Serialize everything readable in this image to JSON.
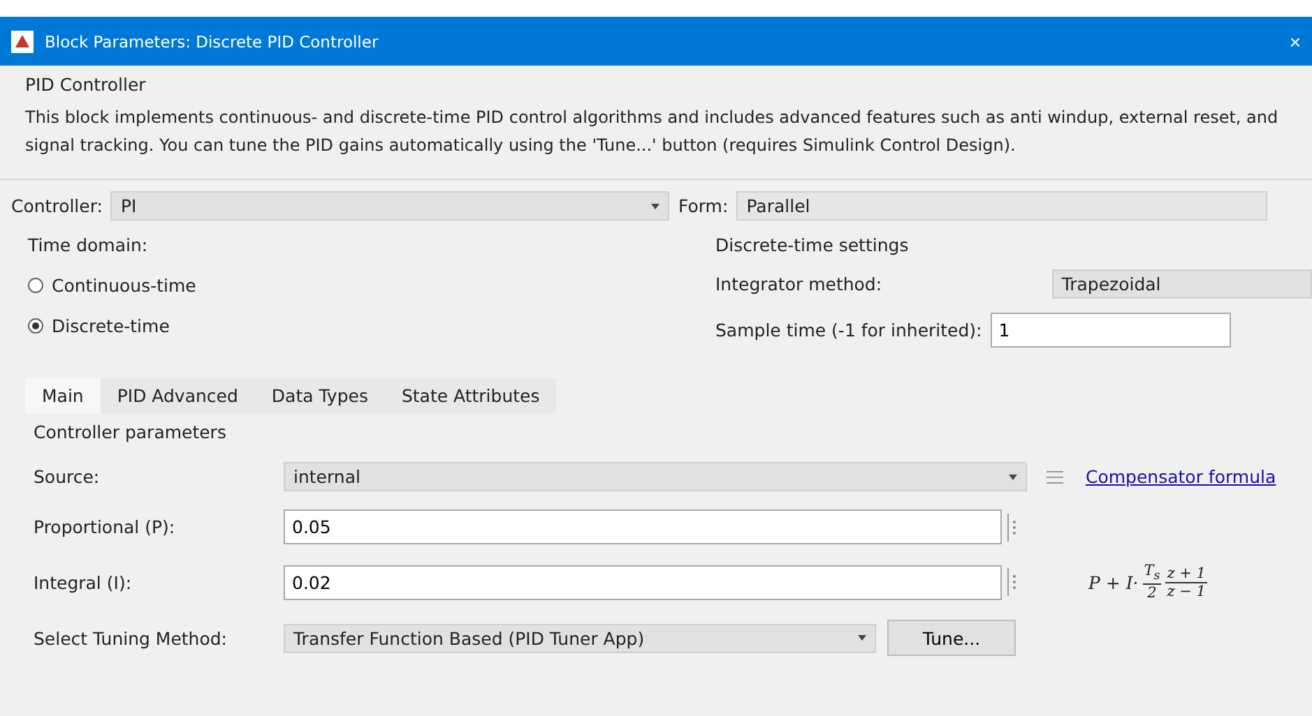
{
  "window": {
    "title": "Block Parameters: Discrete PID Controller",
    "close": "×"
  },
  "block": {
    "name": "PID Controller",
    "description": "This block implements continuous- and discrete-time PID control algorithms and includes advanced features such as anti windup, external reset, and signal tracking. You can tune the PID gains automatically using the 'Tune...' button (requires Simulink Control Design)."
  },
  "controller": {
    "label": "Controller:",
    "value": "PI"
  },
  "form": {
    "label": "Form:",
    "value": "Parallel"
  },
  "time_domain": {
    "label": "Time domain:",
    "options": [
      {
        "label": "Continuous-time",
        "selected": false
      },
      {
        "label": "Discrete-time",
        "selected": true
      }
    ]
  },
  "discrete_settings": {
    "title": "Discrete-time settings",
    "integrator_label": "Integrator method:",
    "integrator_value": "Trapezoidal",
    "sample_label": "Sample time (-1 for inherited):",
    "sample_value": "1"
  },
  "tabs": [
    {
      "label": "Main",
      "selected": true
    },
    {
      "label": "PID Advanced",
      "selected": false
    },
    {
      "label": "Data Types",
      "selected": false
    },
    {
      "label": "State Attributes",
      "selected": false
    }
  ],
  "parameters": {
    "title": "Controller parameters",
    "rows": [
      {
        "kind": "dropdown",
        "label": "Source:",
        "value": "internal"
      },
      {
        "kind": "field",
        "label": "Proportional (P):",
        "value": "0.05"
      },
      {
        "kind": "field",
        "label": "Integral (I):",
        "value": "0.02"
      },
      {
        "kind": "tuning",
        "label": "Select Tuning Method:",
        "value": "Transfer Function Based (PID Tuner App)",
        "button": "Tune..."
      }
    ],
    "link": "Compensator formula",
    "formula": {
      "lead": "P + I·",
      "fractions": [
        {
          "num": "T$_{s}$",
          "den": "2"
        },
        {
          "num": "z + 1",
          "den": "z − 1"
        }
      ]
    }
  }
}
